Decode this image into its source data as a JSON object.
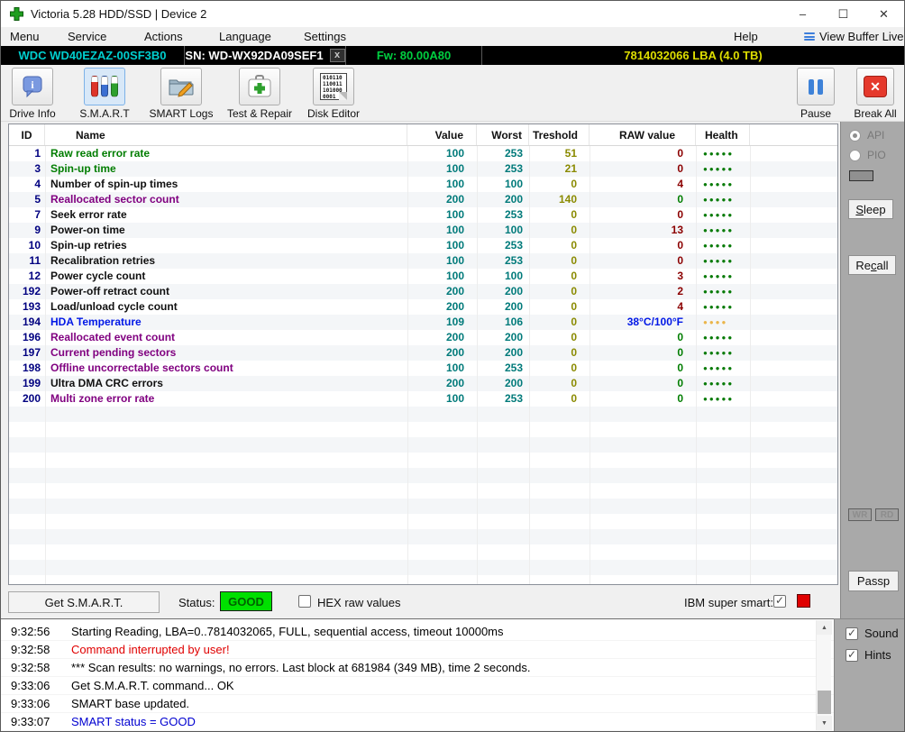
{
  "window": {
    "title": "Victoria 5.28 HDD/SSD | Device 2",
    "minimize": "–",
    "maximize": "☐",
    "close": "✕"
  },
  "menu_bar": {
    "items": [
      "Menu",
      "Service",
      "Actions",
      "Language",
      "Settings",
      "Help"
    ],
    "view_buffer_live": "View Buffer Live"
  },
  "device_bar": {
    "model": "WDC WD40EZAZ-00SF3B0",
    "serial": "SN: WD-WX92DA09SEF1",
    "close_tab": "x",
    "firmware": "Fw: 80.00A80",
    "capacity": "7814032066 LBA (4.0 TB)"
  },
  "toolbar": {
    "drive_info": "Drive Info",
    "smart": "S.M.A.R.T",
    "smart_logs": "SMART Logs",
    "test_repair": "Test & Repair",
    "disk_editor": "Disk Editor",
    "disk_editor_icon_lines": [
      "010110",
      "110011",
      "101000",
      "0001"
    ],
    "pause": "Pause",
    "break_all": "Break All"
  },
  "smart_table": {
    "columns": [
      "ID",
      "Name",
      "Value",
      "Worst",
      "Treshold",
      "RAW value",
      "Health"
    ],
    "rows": [
      {
        "id": "1",
        "name": "Raw read error rate",
        "name_color": "#007d00",
        "value": "100",
        "worst": "253",
        "treshold": "51",
        "raw": "0",
        "raw_color": "#8b0000",
        "dots": 5,
        "dot_color": "#067a06"
      },
      {
        "id": "3",
        "name": "Spin-up time",
        "name_color": "#007d00",
        "value": "100",
        "worst": "253",
        "treshold": "21",
        "raw": "0",
        "raw_color": "#8b0000",
        "dots": 5,
        "dot_color": "#067a06"
      },
      {
        "id": "4",
        "name": "Number of spin-up times",
        "name_color": "#101010",
        "value": "100",
        "worst": "100",
        "treshold": "0",
        "raw": "4",
        "raw_color": "#8b0000",
        "dots": 5,
        "dot_color": "#067a06"
      },
      {
        "id": "5",
        "name": "Reallocated sector count",
        "name_color": "#800080",
        "value": "200",
        "worst": "200",
        "treshold": "140",
        "raw": "0",
        "raw_color": "#007d00",
        "dots": 5,
        "dot_color": "#067a06"
      },
      {
        "id": "7",
        "name": "Seek error rate",
        "name_color": "#101010",
        "value": "100",
        "worst": "253",
        "treshold": "0",
        "raw": "0",
        "raw_color": "#8b0000",
        "dots": 5,
        "dot_color": "#067a06"
      },
      {
        "id": "9",
        "name": "Power-on time",
        "name_color": "#101010",
        "value": "100",
        "worst": "100",
        "treshold": "0",
        "raw": "13",
        "raw_color": "#8b0000",
        "dots": 5,
        "dot_color": "#067a06"
      },
      {
        "id": "10",
        "name": "Spin-up retries",
        "name_color": "#101010",
        "value": "100",
        "worst": "253",
        "treshold": "0",
        "raw": "0",
        "raw_color": "#8b0000",
        "dots": 5,
        "dot_color": "#067a06"
      },
      {
        "id": "11",
        "name": "Recalibration retries",
        "name_color": "#101010",
        "value": "100",
        "worst": "253",
        "treshold": "0",
        "raw": "0",
        "raw_color": "#8b0000",
        "dots": 5,
        "dot_color": "#067a06"
      },
      {
        "id": "12",
        "name": "Power cycle count",
        "name_color": "#101010",
        "value": "100",
        "worst": "100",
        "treshold": "0",
        "raw": "3",
        "raw_color": "#8b0000",
        "dots": 5,
        "dot_color": "#067a06"
      },
      {
        "id": "192",
        "name": "Power-off retract count",
        "name_color": "#101010",
        "value": "200",
        "worst": "200",
        "treshold": "0",
        "raw": "2",
        "raw_color": "#8b0000",
        "dots": 5,
        "dot_color": "#067a06"
      },
      {
        "id": "193",
        "name": "Load/unload cycle count",
        "name_color": "#101010",
        "value": "200",
        "worst": "200",
        "treshold": "0",
        "raw": "4",
        "raw_color": "#8b0000",
        "dots": 5,
        "dot_color": "#067a06"
      },
      {
        "id": "194",
        "name": "HDA Temperature",
        "name_color": "#0017e6",
        "value": "109",
        "worst": "106",
        "treshold": "0",
        "raw": "38°C/100°F",
        "raw_color": "#0017e6",
        "dots": 4,
        "dot_color": "#eab54a"
      },
      {
        "id": "196",
        "name": "Reallocated event count",
        "name_color": "#800080",
        "value": "200",
        "worst": "200",
        "treshold": "0",
        "raw": "0",
        "raw_color": "#007d00",
        "dots": 5,
        "dot_color": "#067a06"
      },
      {
        "id": "197",
        "name": "Current pending sectors",
        "name_color": "#800080",
        "value": "200",
        "worst": "200",
        "treshold": "0",
        "raw": "0",
        "raw_color": "#007d00",
        "dots": 5,
        "dot_color": "#067a06"
      },
      {
        "id": "198",
        "name": "Offline uncorrectable sectors count",
        "name_color": "#800080",
        "value": "100",
        "worst": "253",
        "treshold": "0",
        "raw": "0",
        "raw_color": "#007d00",
        "dots": 5,
        "dot_color": "#067a06"
      },
      {
        "id": "199",
        "name": "Ultra DMA CRC errors",
        "name_color": "#101010",
        "value": "200",
        "worst": "200",
        "treshold": "0",
        "raw": "0",
        "raw_color": "#007d00",
        "dots": 5,
        "dot_color": "#067a06"
      },
      {
        "id": "200",
        "name": "Multi zone error rate",
        "name_color": "#800080",
        "value": "100",
        "worst": "253",
        "treshold": "0",
        "raw": "0",
        "raw_color": "#007d00",
        "dots": 5,
        "dot_color": "#067a06"
      }
    ]
  },
  "sidebar": {
    "api_label": "API",
    "pio_label": "PIO",
    "sleep": {
      "pre": "",
      "key": "S",
      "post": "leep"
    },
    "recall": {
      "pre": "Re",
      "key": "c",
      "post": "all"
    },
    "wr": "WR",
    "rd": "RD",
    "passp": "Passp"
  },
  "status_bar": {
    "get_smart": "Get S.M.A.R.T.",
    "status_label": "Status:",
    "status_value": "GOOD",
    "hex_label": "HEX raw values",
    "ibm_label": "IBM super smart:"
  },
  "log_panel": {
    "entries": [
      {
        "time": "9:32:56",
        "text": "Starting Reading, LBA=0..7814032065, FULL, sequential access, timeout 10000ms",
        "color": "#000000"
      },
      {
        "time": "9:32:58",
        "text": "Command interrupted by user!",
        "color": "#e00000"
      },
      {
        "time": "9:32:58",
        "text": "*** Scan results: no warnings, no errors. Last block at 681984 (349 MB), time 2 seconds.",
        "color": "#000000"
      },
      {
        "time": "9:33:06",
        "text": "Get S.M.A.R.T. command... OK",
        "color": "#000000"
      },
      {
        "time": "9:33:06",
        "text": "SMART base updated.",
        "color": "#000000"
      },
      {
        "time": "9:33:07",
        "text": "SMART status = GOOD",
        "color": "#0000d0"
      }
    ],
    "sound_label": "Sound",
    "hints_label": "Hints"
  },
  "colors": {
    "model_text": "#00cfcf",
    "firmware_text": "#00cf40",
    "capacity_text": "#dede00",
    "value_text": "#007a7a",
    "treshold_text": "#8a8a00",
    "id_text": "#000080",
    "status_good_bg": "#00e000",
    "status_good_text": "#006000",
    "led_red": "#e00000",
    "health_green": "#067a06",
    "health_amber": "#eab54a"
  }
}
